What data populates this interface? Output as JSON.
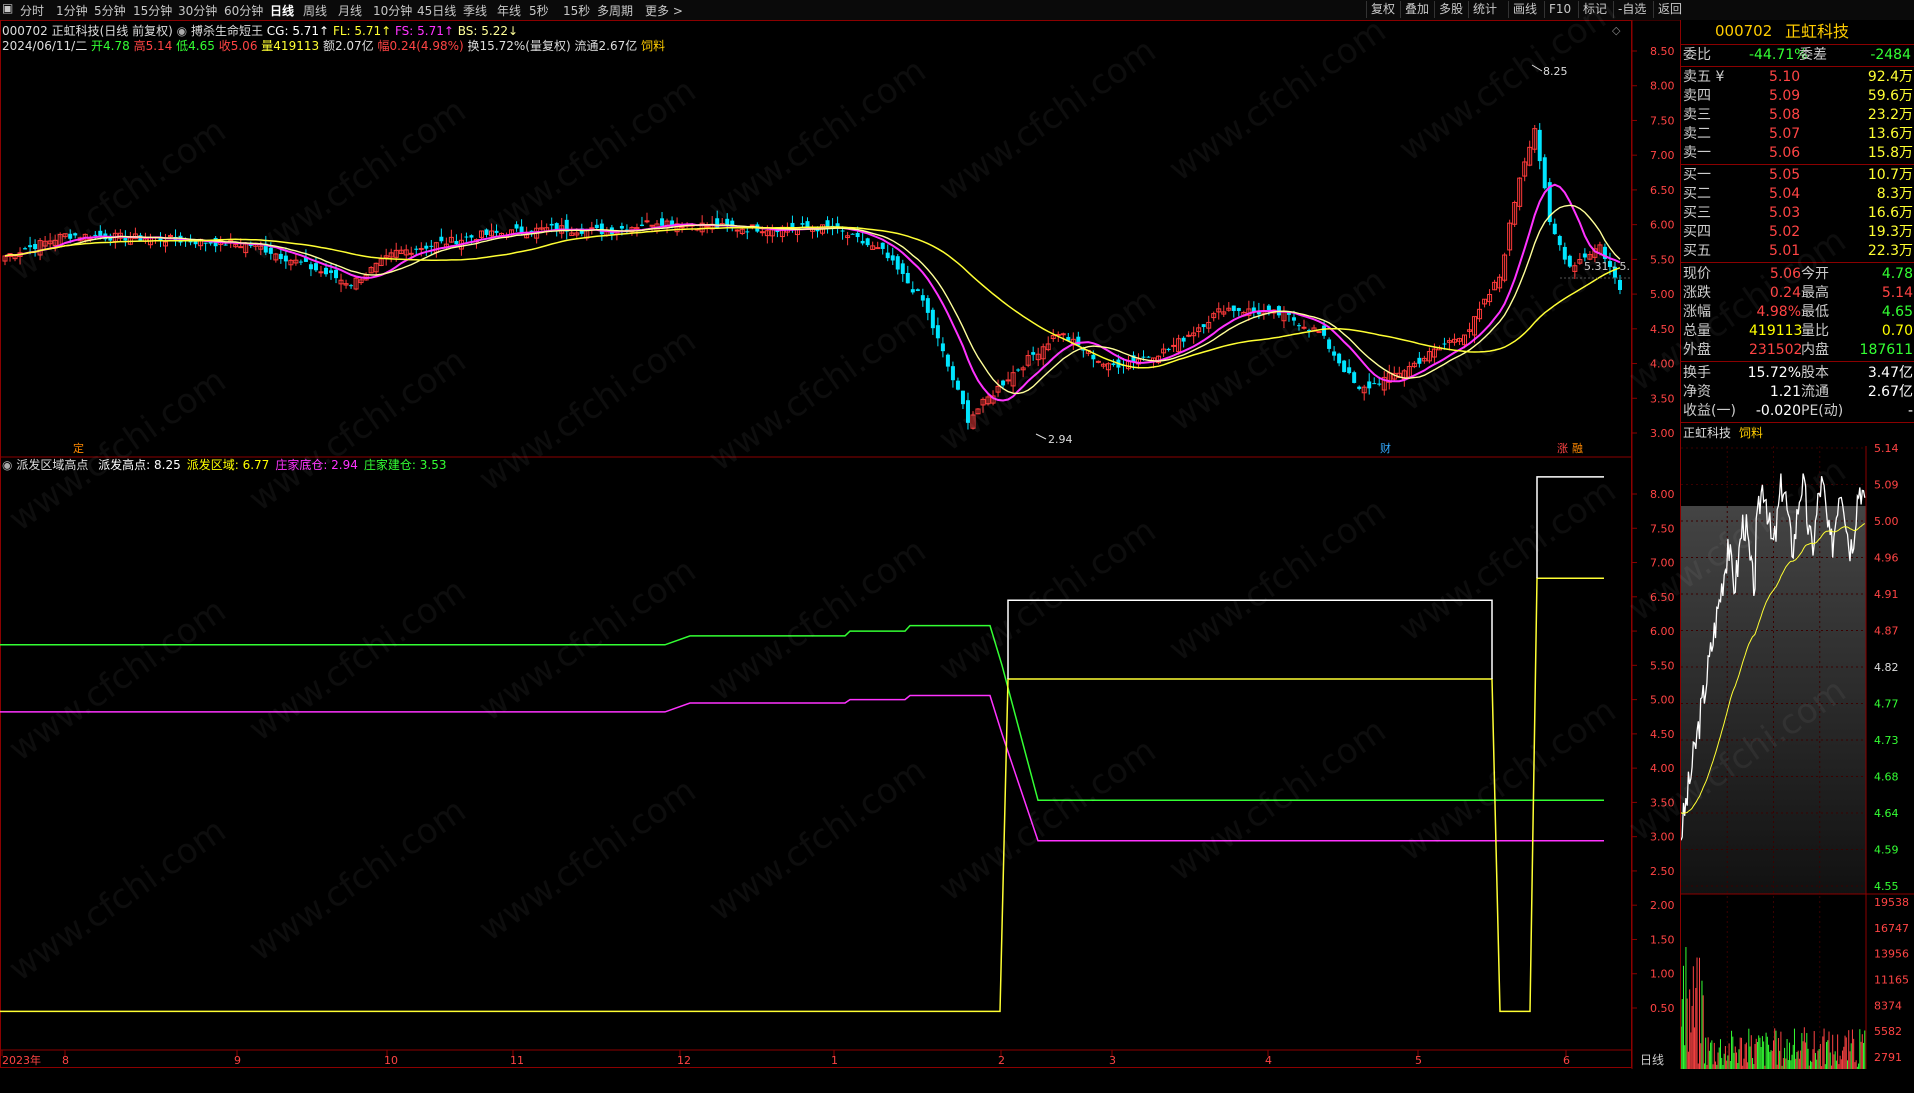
{
  "toolbar": {
    "periods": [
      "分时",
      "1分钟",
      "5分钟",
      "15分钟",
      "30分钟",
      "60分钟",
      "日线",
      "周线",
      "月线",
      "10分钟",
      "45日线",
      "季线",
      "年线",
      "5秒",
      "15秒",
      "多周期",
      "更多 >"
    ],
    "active": "日线",
    "right_buttons": [
      "复权",
      "叠加",
      "多股",
      "统计",
      "画线",
      "F10",
      "标记",
      "-自选",
      "返回"
    ]
  },
  "kline": {
    "title": "000702 正虹科技(日线 前复权)",
    "indicator_name": "搏杀生命短王",
    "cg": "CG: 5.71↑",
    "fl": "FL: 5.71↑",
    "fs": "FS: 5.71↑",
    "bs": "BS: 5.22↓",
    "date": "2024/06/11/二",
    "open": "开4.78",
    "high": "高5.14",
    "low": "低4.65",
    "close": "收5.06",
    "volume": "量419113",
    "amount": "额2.07亿",
    "change": "幅0.24(4.98%)",
    "turnover": "换15.72%(量复权)",
    "float_cap": "流通2.67亿",
    "concept": "饲料",
    "high_label": "8.25",
    "low_label": "2.94",
    "price_mark": "5.31 - 5.",
    "markers": [
      "定",
      "财",
      "涨",
      "融"
    ],
    "yaxis": [
      "8.50",
      "8.00",
      "7.50",
      "7.00",
      "6.50",
      "6.00",
      "5.50",
      "5.00",
      "4.50",
      "4.00",
      "3.50",
      "3.00"
    ]
  },
  "indicator": {
    "name": "派发区域高点",
    "items": [
      {
        "label": "派发高点: 8.25",
        "color": "#ffffff"
      },
      {
        "label": "派发区域: 6.77",
        "color": "#ffff00"
      },
      {
        "label": "庄家底仓: 2.94",
        "color": "#ff33ff"
      },
      {
        "label": "庄家建仓: 3.53",
        "color": "#33ff33"
      }
    ],
    "yaxis": [
      "8.00",
      "7.50",
      "7.00",
      "6.50",
      "6.00",
      "5.50",
      "5.00",
      "4.50",
      "4.00",
      "3.50",
      "3.00",
      "2.50",
      "2.00",
      "1.50",
      "1.00",
      "0.50"
    ]
  },
  "xaxis": {
    "labels": [
      "2023年",
      "8",
      "9",
      "10",
      "11",
      "12",
      "1",
      "2",
      "3",
      "4",
      "5",
      "6"
    ],
    "period_label": "日线"
  },
  "quote": {
    "code": "000702",
    "name": "正虹科技",
    "weibi_label": "委比",
    "weibi": "-44.71%",
    "weicha_label": "委差",
    "weicha": "-2484",
    "sells": [
      {
        "label": "卖五 ¥",
        "price": "5.10",
        "vol": "92.4万"
      },
      {
        "label": "卖四",
        "price": "5.09",
        "vol": "59.6万"
      },
      {
        "label": "卖三",
        "price": "5.08",
        "vol": "23.2万"
      },
      {
        "label": "卖二",
        "price": "5.07",
        "vol": "13.6万"
      },
      {
        "label": "卖一",
        "price": "5.06",
        "vol": "15.8万"
      }
    ],
    "buys": [
      {
        "label": "买一",
        "price": "5.05",
        "vol": "10.7万"
      },
      {
        "label": "买二",
        "price": "5.04",
        "vol": "8.3万"
      },
      {
        "label": "买三",
        "price": "5.03",
        "vol": "16.6万"
      },
      {
        "label": "买四",
        "price": "5.02",
        "vol": "19.3万"
      },
      {
        "label": "买五",
        "price": "5.01",
        "vol": "22.3万"
      }
    ],
    "stats": [
      {
        "l1": "现价",
        "v1": "5.06",
        "c1": "#ff4444",
        "l2": "今开",
        "v2": "4.78",
        "c2": "#33ff33"
      },
      {
        "l1": "涨跌",
        "v1": "0.24",
        "c1": "#ff4444",
        "l2": "最高",
        "v2": "5.14",
        "c2": "#ff4444"
      },
      {
        "l1": "涨幅",
        "v1": "4.98%",
        "c1": "#ff4444",
        "l2": "最低",
        "v2": "4.65",
        "c2": "#33ff33"
      },
      {
        "l1": "总量",
        "v1": "419113",
        "c1": "#ffff00",
        "l2": "量比",
        "v2": "0.70",
        "c2": "#ffff00"
      },
      {
        "l1": "外盘",
        "v1": "231502",
        "c1": "#ff4444",
        "l2": "内盘",
        "v2": "187611",
        "c2": "#33ff33"
      }
    ],
    "stats2": [
      {
        "l1": "换手",
        "v1": "15.72%",
        "l2": "股本",
        "v2": "3.47亿"
      },
      {
        "l1": "净资",
        "v1": "1.21",
        "l2": "流通",
        "v2": "2.67亿"
      },
      {
        "l1": "收益(一)",
        "v1": "-0.020",
        "l2": "PE(动)",
        "v2": "-"
      }
    ],
    "mini_title": "正虹科技",
    "mini_concept": "饲料",
    "mini_yaxis": [
      "5.14",
      "5.09",
      "5.00",
      "4.96",
      "4.91",
      "4.87",
      "4.82",
      "4.77",
      "4.73",
      "4.68",
      "4.64",
      "4.59",
      "4.55"
    ],
    "vol_yaxis": [
      "19538",
      "16747",
      "13956",
      "11165",
      "8374",
      "5582",
      "2791"
    ]
  },
  "watermark": "www.cfchi.com",
  "colors": {
    "up": "#ff3b3b",
    "down": "#00e5ff",
    "ma1": "#ff33ff",
    "ma2": "#ffff33",
    "ma3": "#ffff99",
    "grid": "#8b0000"
  }
}
